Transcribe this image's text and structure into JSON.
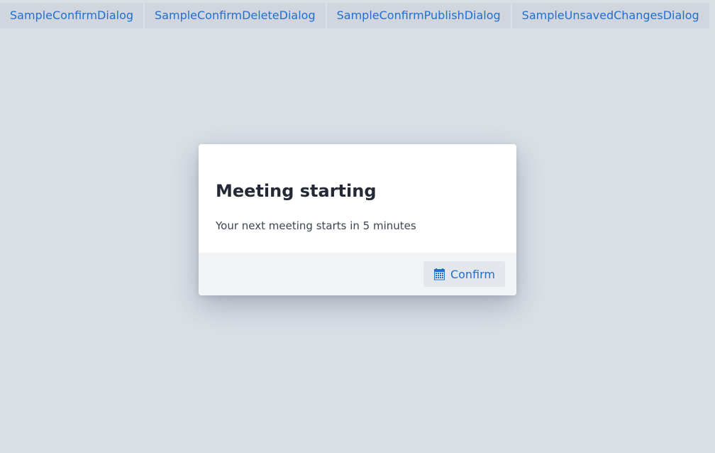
{
  "tabs": [
    {
      "label": "SampleConfirmDialog"
    },
    {
      "label": "SampleConfirmDeleteDialog"
    },
    {
      "label": "SampleConfirmPublishDialog"
    },
    {
      "label": "SampleUnsavedChangesDialog"
    }
  ],
  "dialog": {
    "title": "Meeting starting",
    "message": "Your next meeting starts in 5 minutes",
    "confirm_label": "Confirm",
    "confirm_icon": "calendar-icon"
  },
  "colors": {
    "background": "#dbdfe6",
    "accent": "#1f6fd1",
    "title": "#232a36",
    "footer": "#f2f3f5"
  }
}
